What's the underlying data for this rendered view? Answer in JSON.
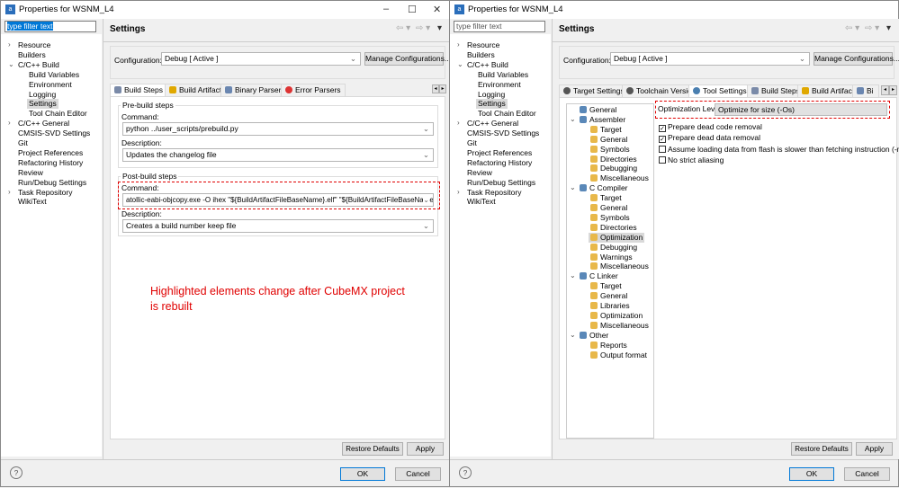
{
  "window_title": "Properties for WSNM_L4",
  "filter_placeholder": "type filter text",
  "tree": [
    {
      "label": "Resource",
      "level": 0,
      "arrow": ">"
    },
    {
      "label": "Builders",
      "level": 0
    },
    {
      "label": "C/C++ Build",
      "level": 0,
      "arrow": "v"
    },
    {
      "label": "Build Variables",
      "level": 1
    },
    {
      "label": "Environment",
      "level": 1
    },
    {
      "label": "Logging",
      "level": 1
    },
    {
      "label": "Settings",
      "level": 1,
      "selected": true
    },
    {
      "label": "Tool Chain Editor",
      "level": 1
    },
    {
      "label": "C/C++ General",
      "level": 0,
      "arrow": ">"
    },
    {
      "label": "CMSIS-SVD Settings",
      "level": 0
    },
    {
      "label": "Git",
      "level": 0
    },
    {
      "label": "Project References",
      "level": 0
    },
    {
      "label": "Refactoring History",
      "level": 0
    },
    {
      "label": "Review",
      "level": 0
    },
    {
      "label": "Run/Debug Settings",
      "level": 0
    },
    {
      "label": "Task Repository",
      "level": 0,
      "arrow": ">"
    },
    {
      "label": "WikiText",
      "level": 0
    }
  ],
  "header": "Settings",
  "configuration_label": "Configuration:",
  "configuration_value": "Debug  [ Active ]",
  "manage_button": "Manage Configurations...",
  "left": {
    "tabs": [
      "Build Steps",
      "Build Artifact",
      "Binary Parsers",
      "Error Parsers"
    ],
    "pre_build": {
      "title": "Pre-build steps",
      "command_label": "Command:",
      "command": "python ../user_scripts/prebuild.py",
      "description_label": "Description:",
      "description": "Updates the changelog file"
    },
    "post_build": {
      "title": "Post-build steps",
      "command_label": "Command:",
      "command": "atollic-eabi-objcopy.exe -O ihex \"${BuildArtifactFileBaseName}.elf\" \"${BuildArtifactFileBaseName}.hex\"",
      "description_label": "Description:",
      "description": "Creates a build number keep file"
    },
    "note": "Highlighted elements change after CubeMX project is rebuilt"
  },
  "right": {
    "tabs": [
      "Target Settings",
      "Toolchain Version",
      "Tool Settings",
      "Build Steps",
      "Build Artifact",
      "Bi"
    ],
    "tool_tree": [
      {
        "label": "General",
        "level": 0
      },
      {
        "label": "Assembler",
        "level": 0,
        "arrow": "v"
      },
      {
        "label": "Target",
        "level": 1
      },
      {
        "label": "General",
        "level": 1
      },
      {
        "label": "Symbols",
        "level": 1
      },
      {
        "label": "Directories",
        "level": 1
      },
      {
        "label": "Debugging",
        "level": 1
      },
      {
        "label": "Miscellaneous",
        "level": 1
      },
      {
        "label": "C Compiler",
        "level": 0,
        "arrow": "v"
      },
      {
        "label": "Target",
        "level": 1
      },
      {
        "label": "General",
        "level": 1
      },
      {
        "label": "Symbols",
        "level": 1
      },
      {
        "label": "Directories",
        "level": 1
      },
      {
        "label": "Optimization",
        "level": 1,
        "selected": true
      },
      {
        "label": "Debugging",
        "level": 1
      },
      {
        "label": "Warnings",
        "level": 1
      },
      {
        "label": "Miscellaneous",
        "level": 1
      },
      {
        "label": "C Linker",
        "level": 0,
        "arrow": "v"
      },
      {
        "label": "Target",
        "level": 1
      },
      {
        "label": "General",
        "level": 1
      },
      {
        "label": "Libraries",
        "level": 1
      },
      {
        "label": "Optimization",
        "level": 1
      },
      {
        "label": "Miscellaneous",
        "level": 1
      },
      {
        "label": "Other",
        "level": 0,
        "arrow": "v"
      },
      {
        "label": "Reports",
        "level": 1
      },
      {
        "label": "Output format",
        "level": 1
      }
    ],
    "optimization_label": "Optimization Level",
    "optimization_value": "Optimize for size (-Os)",
    "options": [
      {
        "label": "Prepare dead code removal",
        "checked": true
      },
      {
        "label": "Prepare dead data removal",
        "checked": true
      },
      {
        "label": "Assume loading data from flash is slower than fetching instruction (-mslow-",
        "checked": false
      },
      {
        "label": "No strict aliasing",
        "checked": false
      }
    ]
  },
  "restore_defaults": "Restore Defaults",
  "apply": "Apply",
  "ok": "OK",
  "cancel": "Cancel",
  "colors": {
    "highlight": "#e00000",
    "selection": "#0078d7"
  }
}
